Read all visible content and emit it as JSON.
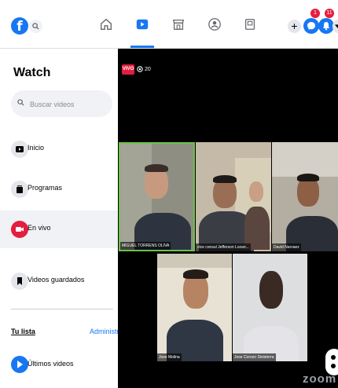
{
  "topbar": {
    "logo_letter": "f",
    "nav_icons": [
      "home-icon",
      "watch-icon",
      "marketplace-icon",
      "groups-icon",
      "gaming-icon"
    ],
    "active_nav": "watch-icon",
    "create_label": "+",
    "messenger_badge": "1",
    "notifications_badge": "11"
  },
  "sidebar": {
    "title": "Watch",
    "search_placeholder": "Buscar videos",
    "items": [
      {
        "label": "Inicio",
        "icon": "tv-icon",
        "active": false
      },
      {
        "label": "Programas",
        "icon": "shows-icon",
        "active": false
      },
      {
        "label": "En vivo",
        "icon": "live-icon",
        "active": true
      },
      {
        "label": "Videos guardados",
        "icon": "saved-icon",
        "active": false
      }
    ],
    "list_title": "Tu lista",
    "manage_label": "Administrar",
    "latest_label": "Últimos videos"
  },
  "video": {
    "live_label": "VIVO",
    "viewer_count": "20",
    "watermark": "zoom",
    "participants": [
      {
        "name": "MIGUEL TORRENS OLIVA",
        "speaking": true
      },
      {
        "name": "vice consul Jefferson Lozan...",
        "speaking": false
      },
      {
        "name": "David Narvaez",
        "speaking": false
      },
      {
        "name": "Jose Molina",
        "speaking": false
      },
      {
        "name": "Jose Corozo Sinisterra",
        "speaking": false
      }
    ]
  },
  "colors": {
    "brand": "#1877f2",
    "live": "#e41e3f",
    "speaker_border": "#6cc24a"
  }
}
